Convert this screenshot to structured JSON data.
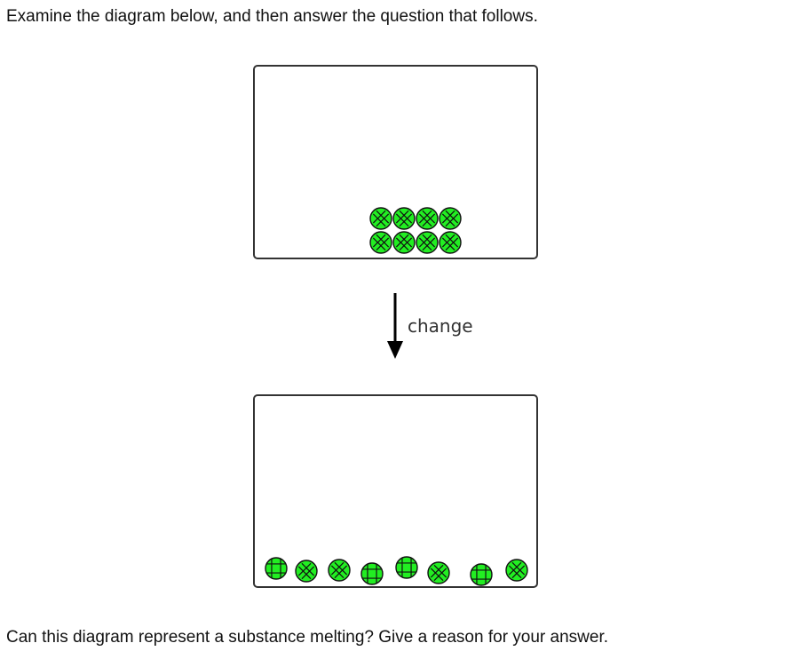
{
  "prompt": {
    "intro": "Examine the diagram below, and then answer the question that follows.",
    "question": "Can this diagram represent a substance melting? Give a reason for your answer."
  },
  "diagram": {
    "arrow_label": "change",
    "particle_color": "#22ee22",
    "before": {
      "arrangement": "packed",
      "rows": 2,
      "columns": 4,
      "particle_count": 8
    },
    "after": {
      "arrangement": "spread out along the bottom",
      "particle_count": 8
    }
  }
}
